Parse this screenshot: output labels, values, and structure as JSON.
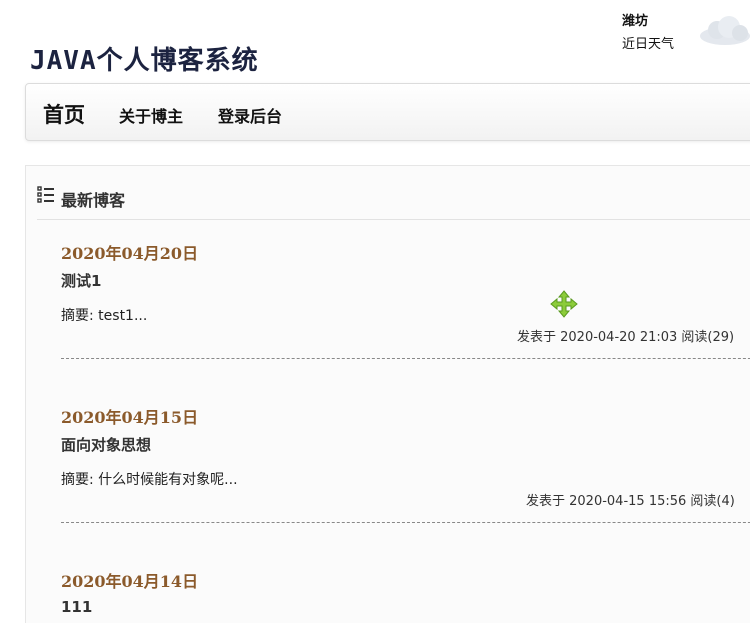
{
  "header": {
    "logo_text": "JAVA个人博客系统",
    "weather": {
      "city": "潍坊",
      "description": "近日天气",
      "icon": "cloud-icon"
    }
  },
  "navbar": {
    "brand": "首页",
    "links": [
      "关于博主",
      "登录后台"
    ]
  },
  "section": {
    "title": "最新博客",
    "icon": "list-icon"
  },
  "posts": [
    {
      "date": "2020年04月20日",
      "title": "测试1",
      "summary": "摘要: test1...",
      "meta": "发表于 2020-04-20 21:03 阅读(29)"
    },
    {
      "date": "2020年04月15日",
      "title": "面向对象思想",
      "summary": "摘要: 什么时候能有对象呢...",
      "meta": "发表于 2020-04-15 15:56 阅读(4)"
    },
    {
      "date": "2020年04月14日",
      "title": "111"
    }
  ],
  "cursor": {
    "icon": "move-cursor-icon"
  },
  "colors": {
    "date": "#8b5a2b",
    "logo": "#1c2340"
  }
}
